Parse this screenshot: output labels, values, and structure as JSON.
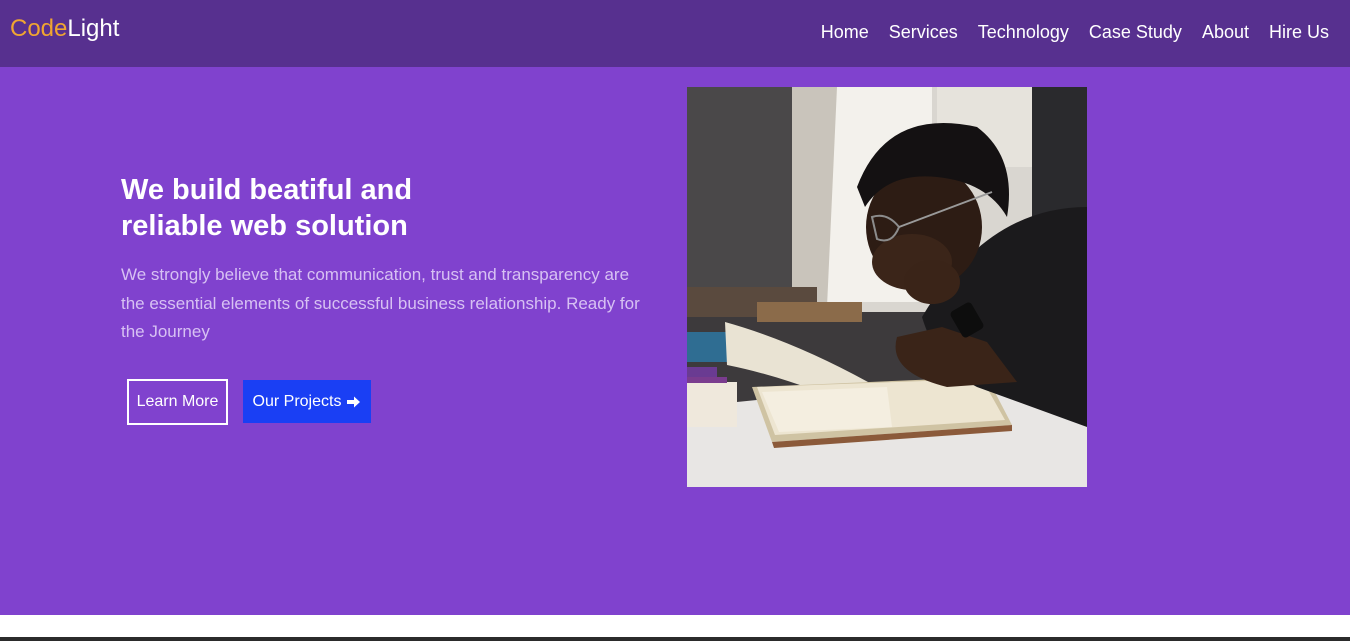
{
  "brand": {
    "part1": "Code",
    "part2": "Light"
  },
  "nav": {
    "items": [
      "Home",
      "Services",
      "Technology",
      "Case Study",
      "About",
      "Hire Us"
    ]
  },
  "hero": {
    "headline": "We build beatiful and reliable web solution",
    "description": "We strongly believe that communication, trust and transparency are the essential elements of successful business relationship. Ready for the Journey",
    "learn_more_label": "Learn More",
    "projects_label": "Our Projects",
    "projects_icon": "arrow-right-icon",
    "image_subject": "man-reading-book-photo"
  },
  "colors": {
    "navbar_bg": "#57308f",
    "hero_bg": "#8042ce",
    "brand_accent": "#f0a531",
    "button_blue": "#1a3ff4",
    "description_text": "#d7c1f3"
  }
}
